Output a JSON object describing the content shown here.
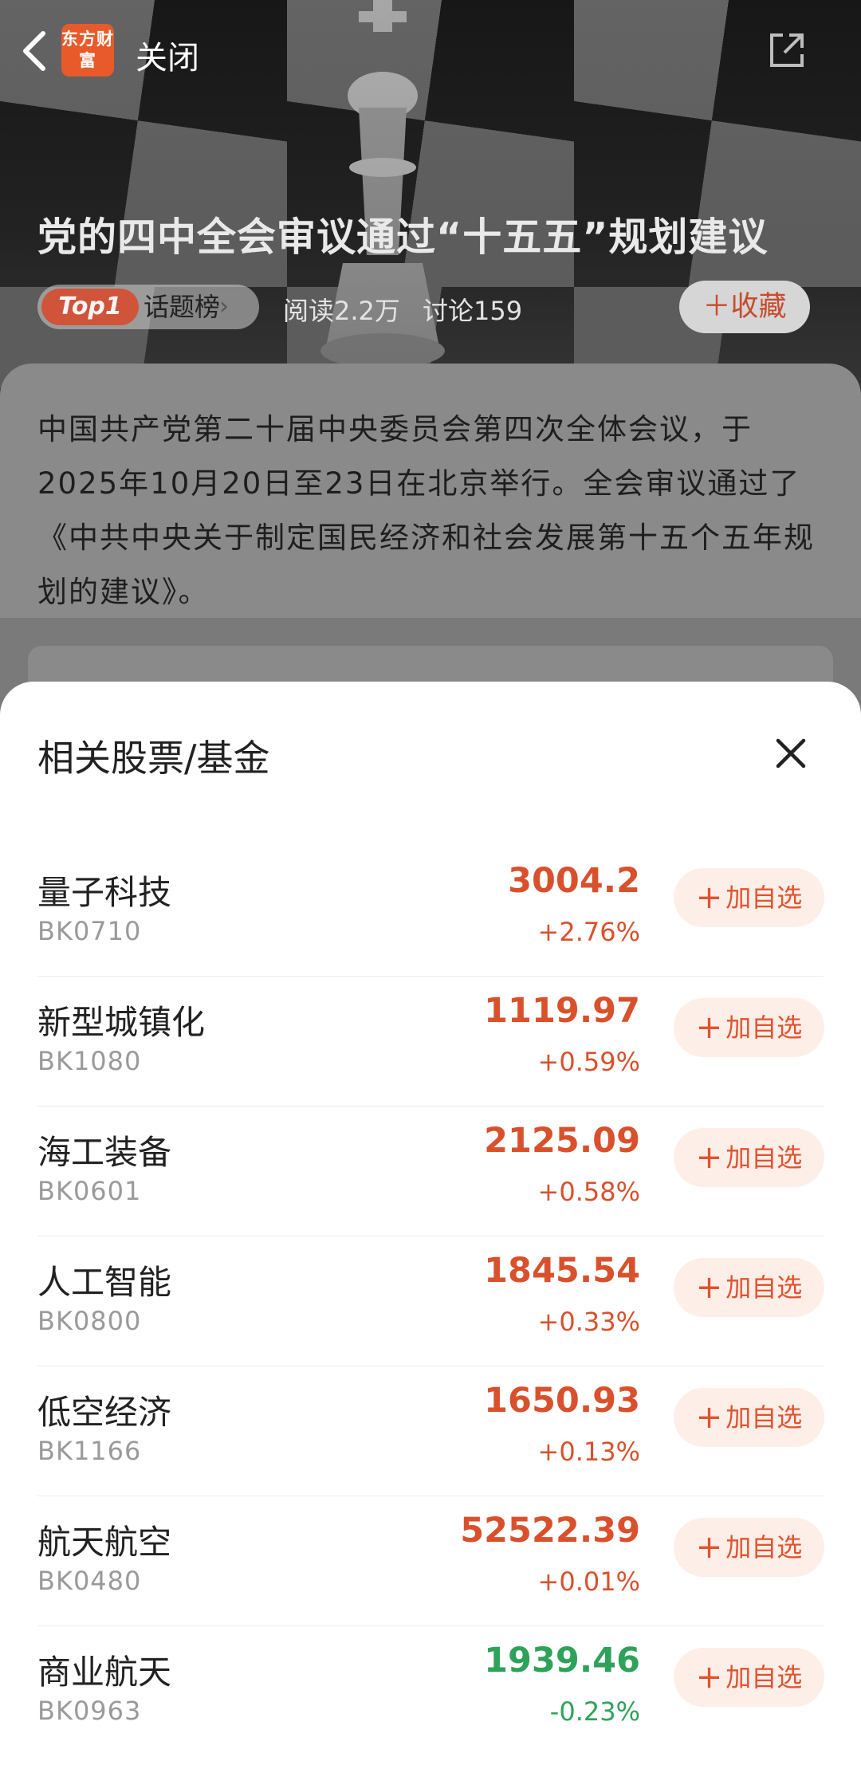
{
  "header": {
    "logo_text": "东方财富",
    "close_label": "关闭"
  },
  "topic": {
    "title": "党的四中全会审议通过“十五五”规划建议",
    "rank_badge": "Top1",
    "rank_label": "话题榜",
    "reads": "阅读2.2万",
    "discussions": "讨论159",
    "favorite_label": "收藏",
    "summary": "中国共产党第二十届中央委员会第四次全体会议，于2025年10月20日至23日在北京举行。全会审议通过了《中共中央关于制定国民经济和社会发展第十五个五年规划的建议》。"
  },
  "sheet": {
    "title": "相关股票/基金",
    "add_label": "加自选",
    "up_color": "#d9512c",
    "down_color": "#2fa25a",
    "items": [
      {
        "name": "量子科技",
        "code": "BK0710",
        "price": "3004.2",
        "change": "+2.76%",
        "direction": "up"
      },
      {
        "name": "新型城镇化",
        "code": "BK1080",
        "price": "1119.97",
        "change": "+0.59%",
        "direction": "up"
      },
      {
        "name": "海工装备",
        "code": "BK0601",
        "price": "2125.09",
        "change": "+0.58%",
        "direction": "up"
      },
      {
        "name": "人工智能",
        "code": "BK0800",
        "price": "1845.54",
        "change": "+0.33%",
        "direction": "up"
      },
      {
        "name": "低空经济",
        "code": "BK1166",
        "price": "1650.93",
        "change": "+0.13%",
        "direction": "up"
      },
      {
        "name": "航天航空",
        "code": "BK0480",
        "price": "52522.39",
        "change": "+0.01%",
        "direction": "up"
      },
      {
        "name": "商业航天",
        "code": "BK0963",
        "price": "1939.46",
        "change": "-0.23%",
        "direction": "down"
      }
    ]
  }
}
